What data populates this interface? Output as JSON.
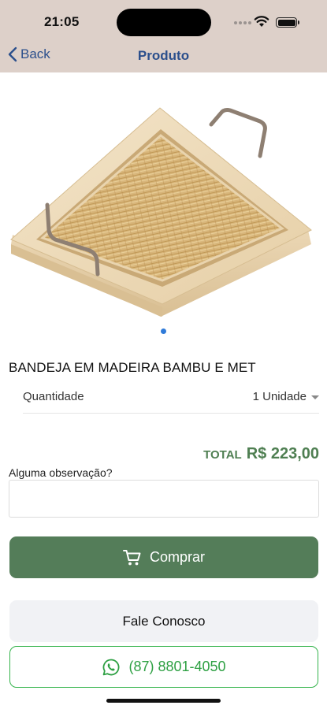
{
  "status_bar": {
    "time": "21:05"
  },
  "nav": {
    "back_label": "Back",
    "title": "Produto"
  },
  "product": {
    "image_icon": "bamboo-tray-photo",
    "carousel_active_color": "#2f7bd9",
    "name": "BANDEJA EM MADEIRA BAMBU E MET",
    "quantity_label": "Quantidade",
    "quantity_value": "1 Unidade"
  },
  "total": {
    "label": "TOTAL",
    "value": "R$ 223,00",
    "color": "#4f7f52"
  },
  "observation": {
    "label": "Alguma observação?",
    "value": ""
  },
  "actions": {
    "buy_label": "Comprar",
    "buy_color": "#547d59",
    "contact_label": "Fale Conosco",
    "whatsapp_label": "(87) 8801-4050",
    "whatsapp_color": "#35b44c"
  }
}
